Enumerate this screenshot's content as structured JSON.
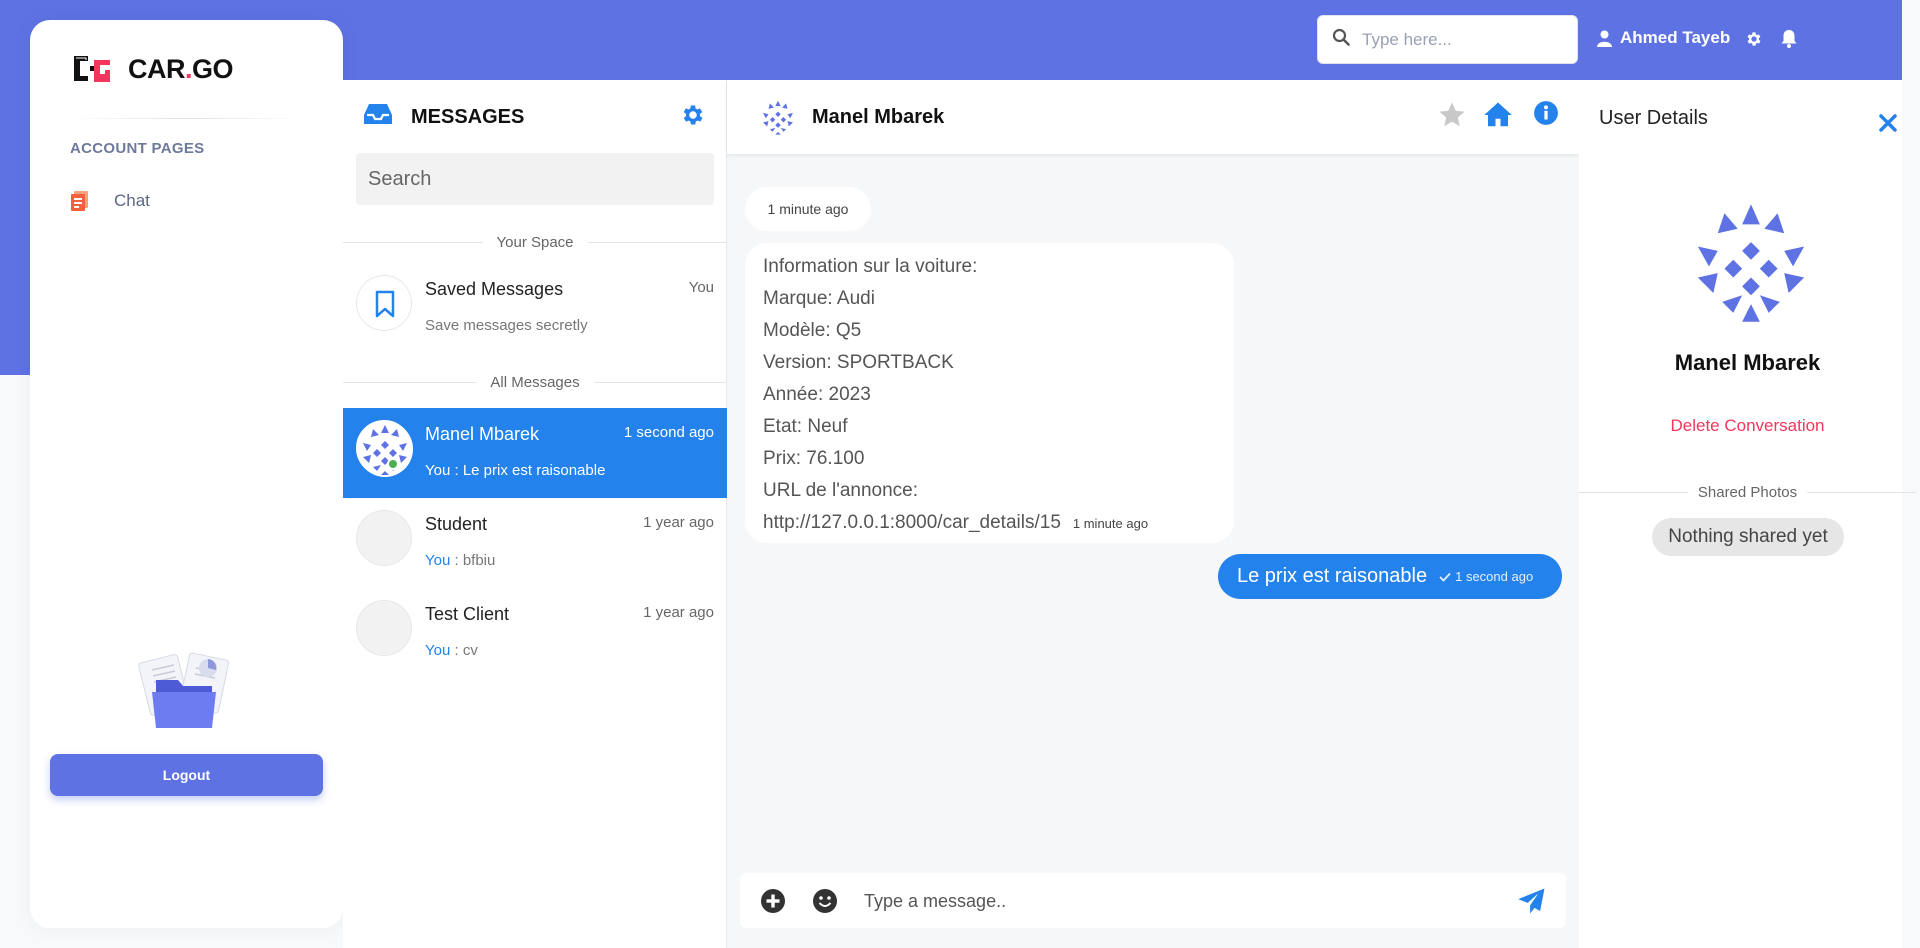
{
  "brand": {
    "name_prefix": "CAR",
    "name_dot": ".",
    "name_suffix": "GO"
  },
  "sidebar": {
    "section_heading": "ACCOUNT PAGES",
    "items": [
      {
        "label": "Chat",
        "icon": "document-icon"
      }
    ],
    "logout_label": "Logout"
  },
  "header": {
    "search_placeholder": "Type here...",
    "user_name": "Ahmed Tayeb"
  },
  "conversations": {
    "title": "MESSAGES",
    "search_placeholder": "Search",
    "your_space_label": "Your Space",
    "all_messages_label": "All Messages",
    "saved": {
      "name": "Saved Messages",
      "time": "You",
      "preview": "Save messages secretly"
    },
    "items": [
      {
        "name": "Manel Mbarek",
        "time": "1 second ago",
        "you": "You",
        "sep": " : ",
        "preview": "Le prix est raisonable"
      },
      {
        "name": "Student",
        "time": "1 year ago",
        "you": "You",
        "sep": " : ",
        "preview": "bfbiu"
      },
      {
        "name": "Test Client",
        "time": "1 year ago",
        "you": "You",
        "sep": " : ",
        "preview": "cv"
      }
    ]
  },
  "chat": {
    "contact_name": "Manel Mbarek",
    "first_time": "1 minute ago",
    "incoming_lines": [
      "Information sur la voiture:",
      "Marque: Audi",
      "Modèle: Q5",
      "Version: SPORTBACK",
      "Année: 2023",
      "Etat: Neuf",
      "Prix: 76.100",
      "URL de l'annonce:",
      "http://127.0.0.1:8000/car_details/15"
    ],
    "incoming_time": "1 minute ago",
    "outgoing_text": "Le prix est raisonable",
    "outgoing_time": "1 second ago",
    "composer_placeholder": "Type a message.."
  },
  "details": {
    "title": "User Details",
    "name": "Manel Mbarek",
    "delete_label": "Delete Conversation",
    "shared_photos_label": "Shared Photos",
    "nothing_shared_label": "Nothing shared yet"
  },
  "colors": {
    "primary": "#5e72e4",
    "chat_blue": "#2382eb",
    "danger": "#f5365c",
    "online": "#4caf50"
  }
}
